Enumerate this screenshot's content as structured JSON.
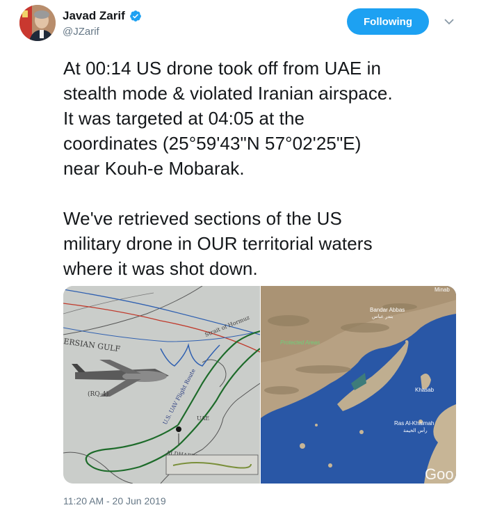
{
  "user": {
    "name": "Javad Zarif",
    "handle": "@JZarif",
    "verified_icon": "verified-badge-icon"
  },
  "actions": {
    "follow_label": "Following",
    "menu_icon": "chevron-down-icon"
  },
  "tweet": {
    "paragraph1": "At 00:14 US drone took off from UAE in\nstealth mode & violated Iranian airspace.\nIt was targeted at 04:05 at the\ncoordinates (25°59'43\"N 57°02'25\"E)\nnear Kouh-e Mobarak.",
    "paragraph2": "We've retrieved sections of the US\nmilitary drone in OUR territorial waters\nwhere it was shot down.",
    "timestamp": "11:20 AM - 20 Jun 2019"
  },
  "map_left": {
    "labels": {
      "gulf": "ERSIAN GULF",
      "strait": "Strait of Hormuz",
      "route": "U.S. UAV Flight Route",
      "uae": "UAE",
      "airbase": "ALDHAFRE AB",
      "drone": "(RQ-4)"
    }
  },
  "map_right": {
    "labels": {
      "minab": "Minab",
      "bandar": "Bandar Abbas",
      "bandar_ar": "بندر عباس",
      "protected": "Protected Areas",
      "khasab": "Khasab",
      "ras": "Ras Al-Khaimah",
      "ras_ar": "رأس الخيمة",
      "google": "Goo"
    }
  },
  "colors": {
    "accent": "#1da1f2",
    "text": "#14171a",
    "muted": "#657786"
  }
}
